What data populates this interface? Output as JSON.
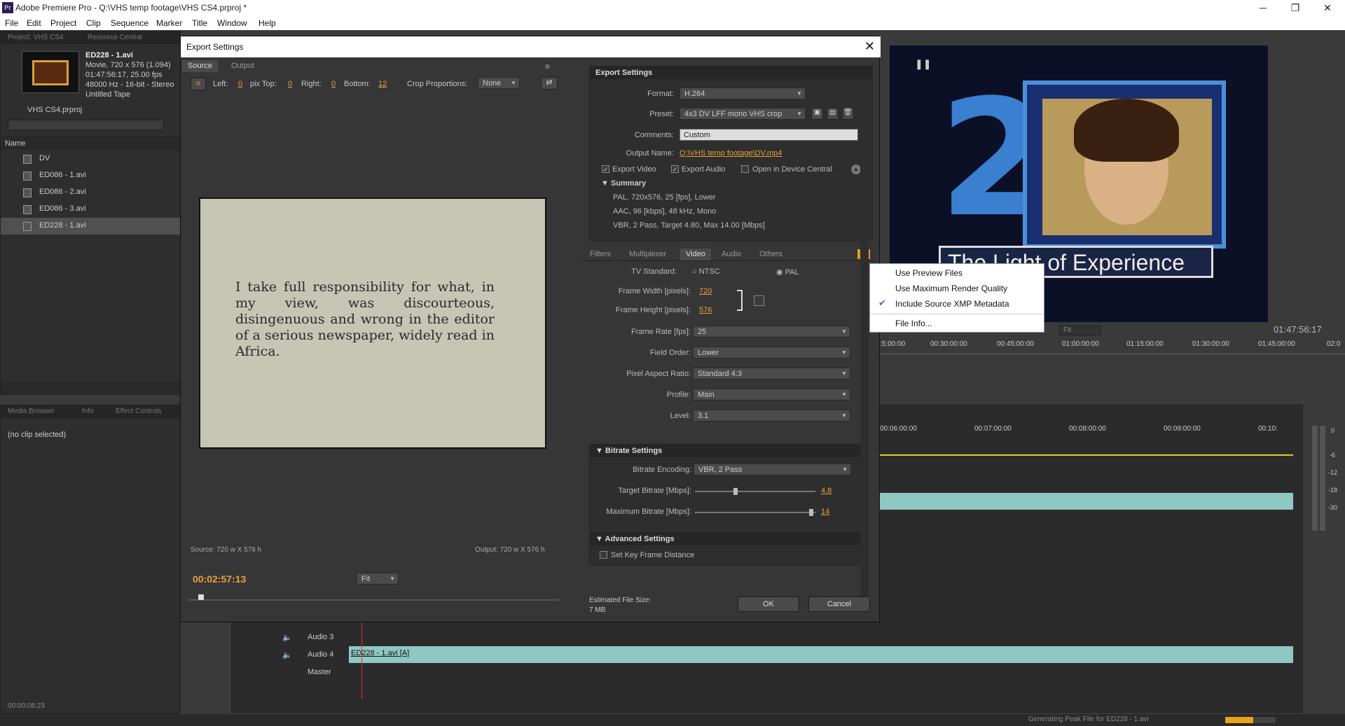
{
  "app": {
    "title": "Adobe Premiere Pro - Q:\\VHS temp footage\\VHS CS4.prproj *",
    "icon": "Pr"
  },
  "menu": [
    "File",
    "Edit",
    "Project",
    "Clip",
    "Sequence",
    "Marker",
    "Title",
    "Window",
    "Help"
  ],
  "project": {
    "tabs": [
      "Project: VHS CS4",
      "Resource Central"
    ],
    "clip": {
      "name": "ED228 - 1.avi",
      "info1": "Movie, 720 x 576 (1.094)",
      "info2": "01:47:56:17, 25.00 fps",
      "info3": "48000 Hz - 16-bit - Stereo",
      "info4": "Untitled Tape"
    },
    "file": "VHS CS4.prproj",
    "column": "Name",
    "items": [
      "DV",
      "ED086 - 1.avi",
      "ED086 - 2.avi",
      "ED086 - 3.avi",
      "ED228 - 1.avi"
    ]
  },
  "effects": {
    "tabs": [
      "Media Browser",
      "Info",
      "Effect Controls"
    ],
    "status": "(no clip selected)"
  },
  "bottom_tc": "00:00:08:23",
  "dialog": {
    "title": "Export Settings",
    "tabs": [
      "Source",
      "Output"
    ],
    "crop": {
      "left_label": "Left:",
      "left": "0",
      "pix_top": "pix Top:",
      "top": "0",
      "right_label": "Right:",
      "right": "0",
      "bottom_label": "Bottom:",
      "bottom": "12",
      "prop_label": "Crop Proportions:",
      "prop": "None"
    },
    "doc_text": "I take full responsibility for what, in my view, was discourteous, disingenuous and wrong in the editor of a serious newspaper, widely read in Africa.",
    "source_dim": "Source: 720 w X 576 h",
    "output_dim": "Output: 720 w X 576 h",
    "timecode": "00:02:57:13",
    "fit": "Fit",
    "export_settings": {
      "header": "Export Settings",
      "format_label": "Format:",
      "format": "H.264",
      "preset_label": "Preset:",
      "preset": "4x3 DV LFF mono VHS crop",
      "comments_label": "Comments:",
      "comments": "Custom",
      "output_label": "Output Name:",
      "output": "Q:\\VHS temp footage\\DV.mp4",
      "export_video": "Export Video",
      "export_audio": "Export Audio",
      "open_dc": "Open in Device Central",
      "summary": "Summary",
      "sum1": "PAL, 720x576, 25 [fps], Lower",
      "sum2": "AAC, 96 [kbps], 48 kHz, Mono",
      "sum3": "VBR, 2 Pass, Target 4.80, Max 14.00 [Mbps]"
    },
    "tabs2": [
      "Filters",
      "Multiplexer",
      "Video",
      "Audio",
      "Others"
    ],
    "video": {
      "tv_label": "TV Standard:",
      "ntsc": "NTSC",
      "pal": "PAL",
      "fw_label": "Frame Width [pixels]:",
      "fw": "720",
      "fh_label": "Frame Height [pixels]:",
      "fh": "576",
      "fr_label": "Frame Rate [fps]:",
      "fr": "25",
      "fo_label": "Field Order:",
      "fo": "Lower",
      "par_label": "Pixel Aspect Ratio:",
      "par": "Standard 4:3",
      "profile_label": "Profile:",
      "profile": "Main",
      "level_label": "Level:",
      "level": "3.1"
    },
    "bitrate": {
      "header": "Bitrate Settings",
      "enc_label": "Bitrate Encoding:",
      "enc": "VBR, 2 Pass",
      "target_label": "Target Bitrate [Mbps]:",
      "target": "4.8",
      "max_label": "Maximum Bitrate [Mbps]:",
      "max": "14",
      "target_frac": 0.33,
      "max_frac": 0.98
    },
    "advanced": {
      "header": "Advanced Settings",
      "keyframe": "Set Key Frame Distance"
    },
    "est_label": "Estimated File Size:",
    "est": "7 MB",
    "ok": "OK",
    "cancel": "Cancel"
  },
  "context_menu": [
    "Use Preview Files",
    "Use Maximum Render Quality",
    "Include Source XMP Metadata",
    "File Info..."
  ],
  "program": {
    "overlay": "The Light of Experience",
    "tc": "01:47:56:17",
    "fit": "Fit",
    "ruler": [
      ":5:00:00",
      "00:30:00:00",
      "00:45:00:00",
      "01:00:00:00",
      "01:15:00:00",
      "01:30:00:00",
      "01:45:00:00",
      "02:0"
    ]
  },
  "timeline": {
    "ruler": [
      "00:06:00:00",
      "00:07:00:00",
      "00:08:00:00",
      "00:09:00:00",
      "00:10:"
    ],
    "tracks": [
      "Audio 3",
      "Audio 4",
      "Master"
    ],
    "clip": "ED228 - 1.avi [A]"
  },
  "meter": [
    "0",
    "-6",
    "-12",
    "-18",
    "-30"
  ],
  "status": "Generating Peak File for ED228 - 1.avi"
}
